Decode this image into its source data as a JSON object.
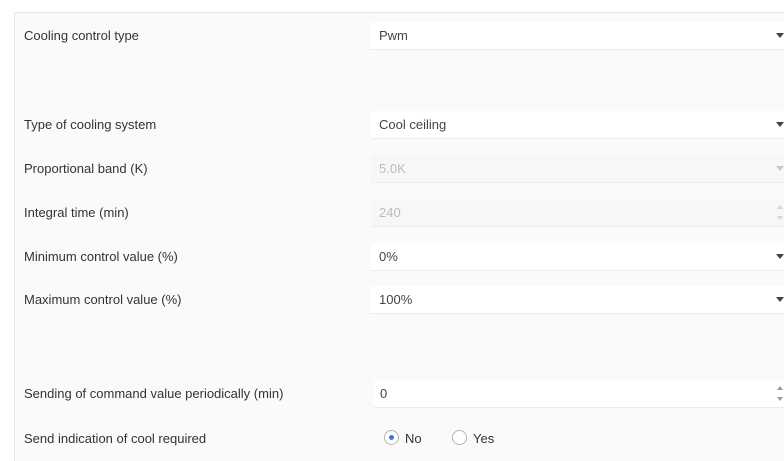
{
  "rows": {
    "cooling_control_type": {
      "label": "Cooling control type",
      "value": "Pwm"
    },
    "type_of_cooling_system": {
      "label": "Type of cooling system",
      "value": "Cool ceiling"
    },
    "proportional_band": {
      "label": "Proportional band (K)",
      "value": "5.0K",
      "disabled": true
    },
    "integral_time": {
      "label": "Integral time (min)",
      "value": "240",
      "disabled": true
    },
    "minimum_control_value": {
      "label": "Minimum control value (%)",
      "value": "0%"
    },
    "maximum_control_value": {
      "label": "Maximum control value (%)",
      "value": "100%"
    },
    "sending_periodically": {
      "label": "Sending of command value periodically (min)",
      "value": "0"
    },
    "send_indication": {
      "label": "Send indication of cool required",
      "options": [
        "No",
        "Yes"
      ],
      "selected": "No"
    }
  },
  "colors": {
    "accent": "#3c7bd6",
    "disabled_text": "#bbbbbb",
    "panel_background": "#fafafa"
  },
  "icons": {
    "dropdown": "chevron-down-icon",
    "spinner": "spin-arrows-icon"
  }
}
